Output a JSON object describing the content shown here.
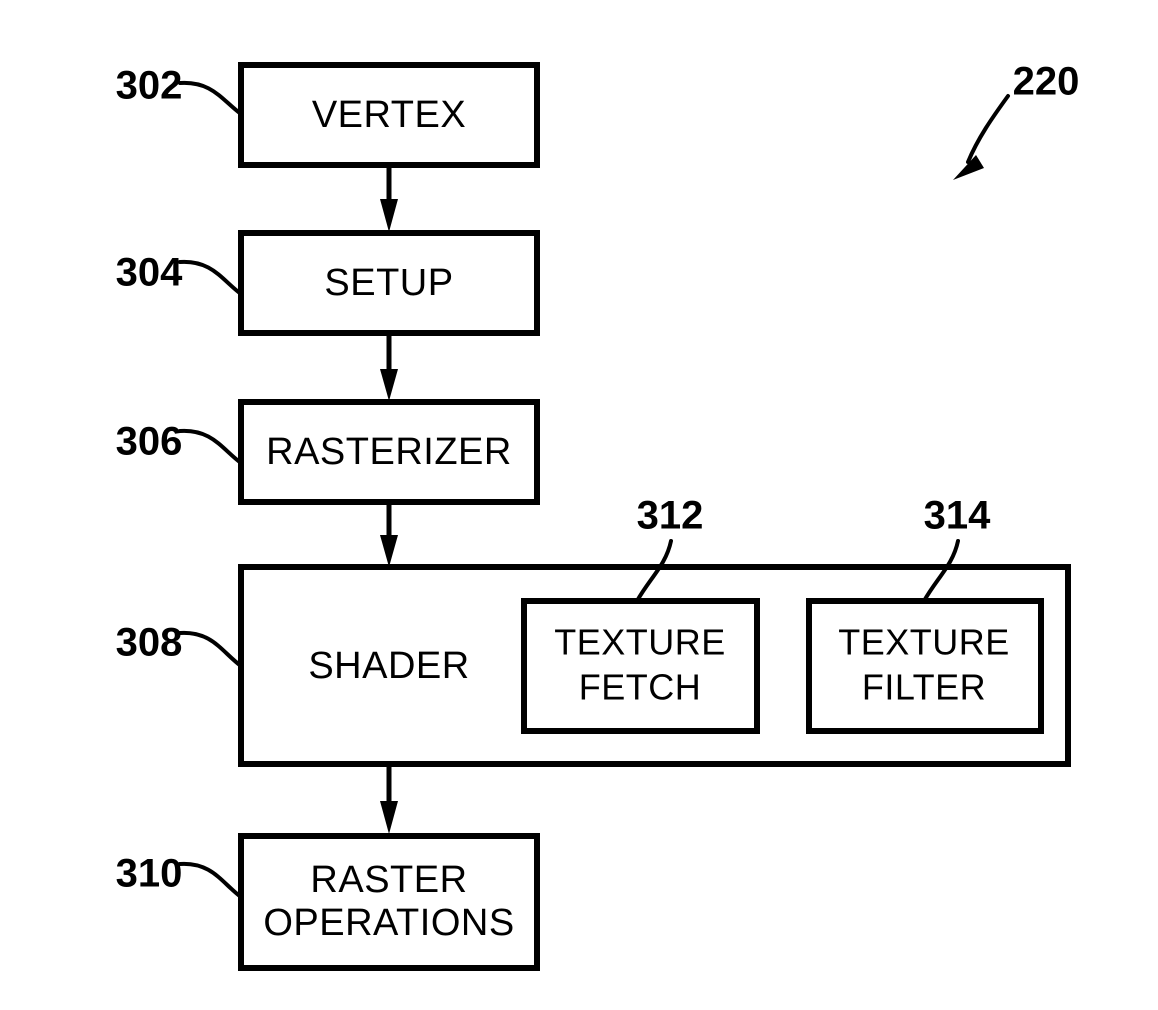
{
  "figure": {
    "figure_reference": "220",
    "background_color": "#ffffff",
    "line_color": "#000000",
    "blocks": [
      {
        "id": "vertex",
        "ref": "302",
        "label": "VERTEX",
        "lines": [
          "VERTEX"
        ]
      },
      {
        "id": "setup",
        "ref": "304",
        "label": "SETUP",
        "lines": [
          "SETUP"
        ]
      },
      {
        "id": "rasterizer",
        "ref": "306",
        "label": "RASTERIZER",
        "lines": [
          "RASTERIZER"
        ]
      },
      {
        "id": "shader",
        "ref": "308",
        "label": "SHADER",
        "lines": [
          "SHADER"
        ]
      },
      {
        "id": "texture-fetch",
        "ref": "312",
        "label": "TEXTURE FETCH",
        "lines": [
          "TEXTURE",
          "FETCH"
        ]
      },
      {
        "id": "texture-filter",
        "ref": "314",
        "label": "TEXTURE FILTER",
        "lines": [
          "TEXTURE",
          "FILTER"
        ]
      },
      {
        "id": "raster-operations",
        "ref": "310",
        "label": "RASTER OPERATIONS",
        "lines": [
          "RASTER",
          "OPERATIONS"
        ]
      }
    ],
    "flow": [
      {
        "from": "vertex",
        "to": "setup"
      },
      {
        "from": "setup",
        "to": "rasterizer"
      },
      {
        "from": "rasterizer",
        "to": "shader"
      },
      {
        "from": "shader",
        "to": "raster-operations"
      }
    ]
  }
}
